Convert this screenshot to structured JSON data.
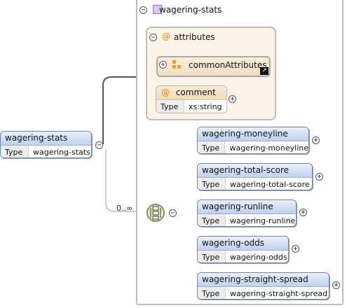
{
  "root": {
    "name": "wagering-stats",
    "type_key": "Type",
    "type_value": "wagering-stats"
  },
  "complex_type": {
    "title": "wagering-stats"
  },
  "attributes": {
    "at_symbol": "@",
    "title": "attributes",
    "group_ref": {
      "name": "commonAttributes",
      "link_glyph": "↗"
    },
    "comment": {
      "name": "comment",
      "type_key": "Type",
      "type_value": "xs:string"
    }
  },
  "sequence": {
    "cardinality": "0..∞"
  },
  "children": [
    {
      "name": "wagering-moneyline",
      "type_key": "Type",
      "type_value": "wagering-moneyline"
    },
    {
      "name": "wagering-total-score",
      "type_key": "Type",
      "type_value": "wagering-total-score"
    },
    {
      "name": "wagering-runline",
      "type_key": "Type",
      "type_value": "wagering-runline"
    },
    {
      "name": "wagering-odds",
      "type_key": "Type",
      "type_value": "wagering-odds"
    },
    {
      "name": "wagering-straight-spread",
      "type_key": "Type",
      "type_value": "wagering-straight-spread"
    }
  ],
  "toggles": {
    "collapse": "−",
    "expand": "+"
  }
}
